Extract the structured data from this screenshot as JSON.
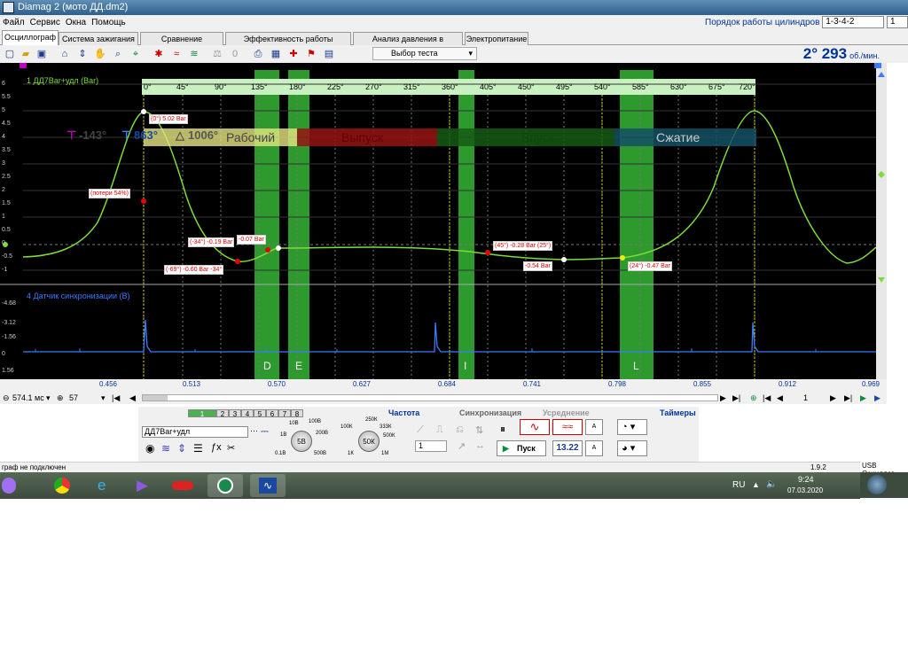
{
  "window": {
    "title": "Diamag 2 (мото ДД.dm2)"
  },
  "menu": [
    "Файл",
    "Сервис",
    "Окна",
    "Помощь"
  ],
  "cylinder_order": {
    "label": "Порядок работы цилиндров",
    "value": "1-3-4-2",
    "spin": "1"
  },
  "tabs": [
    "Осциллограф",
    "Система зажигания",
    "Сравнение цилиндров",
    "Эффективность работы цилиндров",
    "Анализ давления в цилиндре",
    "Электропитание"
  ],
  "toolbar": {
    "test_select": "Выбор теста"
  },
  "rpm": {
    "value": "2° 293",
    "unit": "об./мин."
  },
  "channel1": {
    "label": "1 ДД7Bar+удл (Bar)",
    "y_ticks": [
      "6",
      "5.5",
      "5",
      "4.5",
      "4",
      "3.5",
      "3",
      "2.5",
      "2",
      "1.5",
      "1",
      "0.5",
      "0",
      "-0.5",
      "-1"
    ]
  },
  "channel4": {
    "label": "4 Датчик синхронизации (В)",
    "y_ticks": [
      "-4.68",
      "-3.12",
      "-1.56",
      "0",
      "1.56"
    ]
  },
  "degree_ticks": [
    "0°",
    "45°",
    "90°",
    "135°",
    "180°",
    "225°",
    "270°",
    "315°",
    "360°",
    "405°",
    "450°",
    "495°",
    "540°",
    "585°",
    "630°",
    "675°",
    "720°"
  ],
  "phases": [
    "Рабочий",
    "Выпуск",
    "Впуск",
    "Сжатие"
  ],
  "cursors": {
    "a": "-143°",
    "b": "863°",
    "delta": "1006°"
  },
  "zones": [
    "D",
    "E",
    "I",
    "L"
  ],
  "annotations": [
    "(0°) 5.02 Bar",
    "(потери 54%)",
    "(-34°) -0.19 Bar",
    "-0.07 Bar",
    "(-69°) -0.60 Bar -34°",
    "(45°) -0.28 Bar (25°)",
    "-0.54 Bar",
    "(24°) -0.47 Bar"
  ],
  "x_axis": [
    "0.456",
    "0.513",
    "0.570",
    "0.627",
    "0.684",
    "0.741",
    "0.798",
    "0.855",
    "0.912",
    "0.969"
  ],
  "nav": {
    "timebase": "574.1 мс",
    "count": "57",
    "page": "1"
  },
  "panel": {
    "sections": [
      "Частота",
      "Синхронизация",
      "Усреднение",
      "Таймеры"
    ],
    "channel_name": "ДД7Bar+удл",
    "volt_knob": "5В",
    "volt_labels": [
      "10В",
      "100В",
      "1В",
      "200В",
      "0.1В",
      "500В"
    ],
    "freq_knob": "50К",
    "freq_labels": [
      "100К",
      "250К",
      "333К",
      "500К",
      "1К",
      "1М"
    ],
    "sync_value": "1",
    "start_label": "Пуск",
    "value_label": "13.22",
    "channel_tabs": [
      "1",
      "2",
      "3",
      "4",
      "5",
      "6",
      "7",
      "8"
    ]
  },
  "status": {
    "left": "граф не подключен",
    "version": "1.9.2"
  },
  "taskbar": {
    "lang": "RU",
    "time": "9:24",
    "date": "07.03.2020",
    "usb": "USB Осциллог"
  },
  "colors": {
    "scope_bg": "#000000",
    "trace1": "#7ddc3a",
    "trace4": "#3a7bff",
    "zone": "#2e9a2e",
    "annot": "#e00000"
  }
}
